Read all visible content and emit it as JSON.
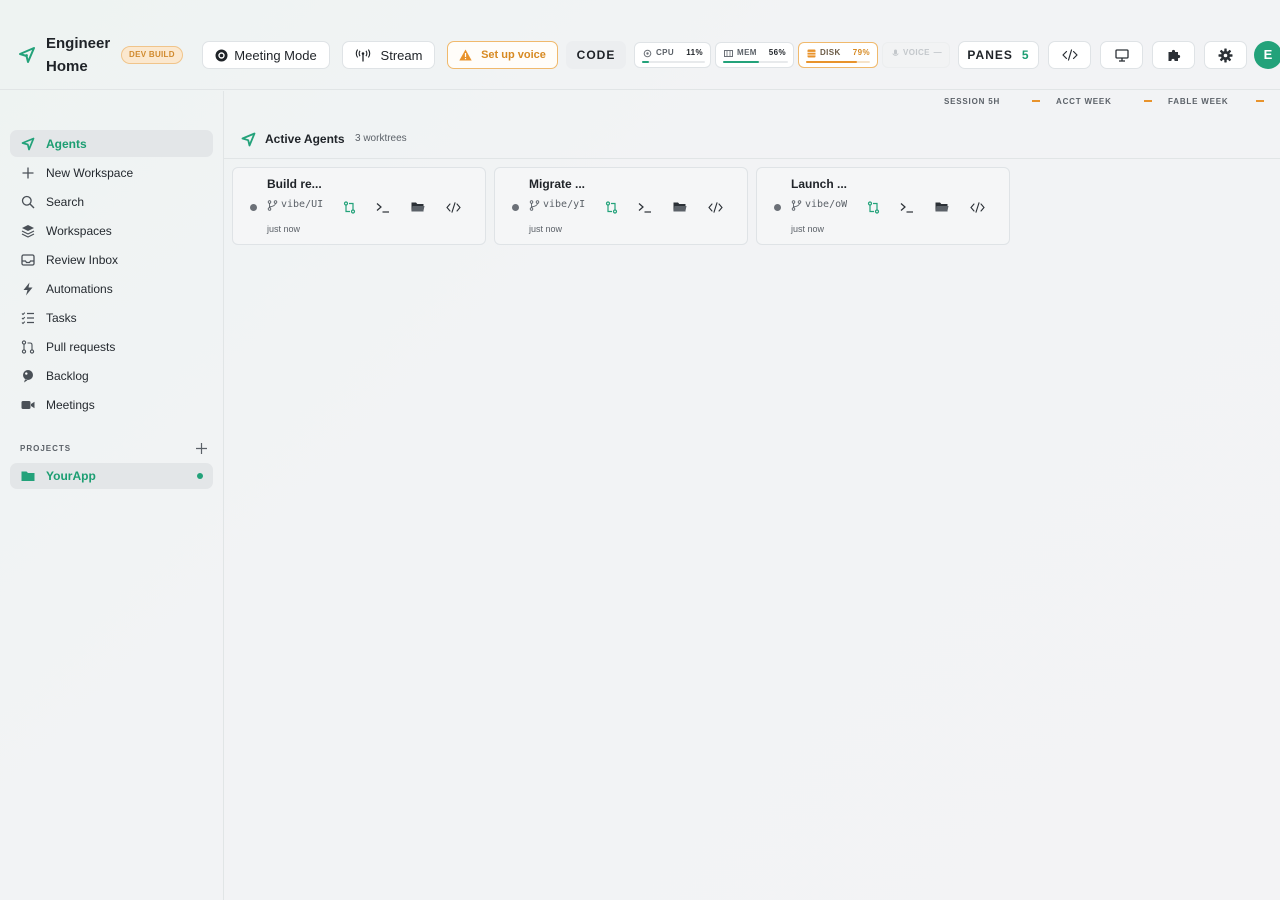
{
  "app": {
    "title": "Engineer Home",
    "badge": "DEV BUILD"
  },
  "toolbar": {
    "meeting_mode": "Meeting Mode",
    "stream": "Stream",
    "setup_voice": "Set up voice",
    "code": "CODE",
    "panes_label": "PANES",
    "panes_count": "5"
  },
  "meters": {
    "cpu": {
      "label": "CPU",
      "value": "11%",
      "fraction": 0.11
    },
    "mem": {
      "label": "MEM",
      "value": "56%",
      "fraction": 0.56
    },
    "disk": {
      "label": "DISK",
      "value": "79%",
      "fraction": 0.79
    },
    "voice": {
      "label": "VOICE",
      "value": "—"
    }
  },
  "usage": {
    "session": {
      "label": "SESSION 5H",
      "value": "—"
    },
    "acct": {
      "label": "ACCT WEEK",
      "value": "—"
    },
    "fable": {
      "label": "FABLE WEEK",
      "value": "—"
    }
  },
  "user": {
    "initial": "E"
  },
  "sidebar": {
    "items": [
      {
        "label": "Agents",
        "icon": "agents-icon",
        "active": true
      },
      {
        "label": "New Workspace",
        "icon": "plus-icon"
      },
      {
        "label": "Search",
        "icon": "search-icon"
      },
      {
        "label": "Workspaces",
        "icon": "layers-icon"
      },
      {
        "label": "Review Inbox",
        "icon": "inbox-icon"
      },
      {
        "label": "Automations",
        "icon": "bolt-icon"
      },
      {
        "label": "Tasks",
        "icon": "tasks-icon"
      },
      {
        "label": "Pull requests",
        "icon": "pull-request-icon"
      },
      {
        "label": "Backlog",
        "icon": "backlog-icon"
      },
      {
        "label": "Meetings",
        "icon": "video-icon"
      }
    ],
    "projects_label": "PROJECTS",
    "projects": [
      {
        "label": "YourApp",
        "icon": "folder-icon"
      }
    ]
  },
  "main": {
    "title": "Active Agents",
    "subtitle": "3 worktrees",
    "agents": [
      {
        "title": "Build re...",
        "branch": "vibe/UI",
        "time": "just now"
      },
      {
        "title": "Migrate ...",
        "branch": "vibe/yI",
        "time": "just now"
      },
      {
        "title": "Launch ...",
        "branch": "vibe/oW",
        "time": "just now"
      }
    ]
  },
  "colors": {
    "accent": "#23a27a",
    "warning": "#e8932c",
    "dev_badge_bg": "#fbe8cf"
  }
}
